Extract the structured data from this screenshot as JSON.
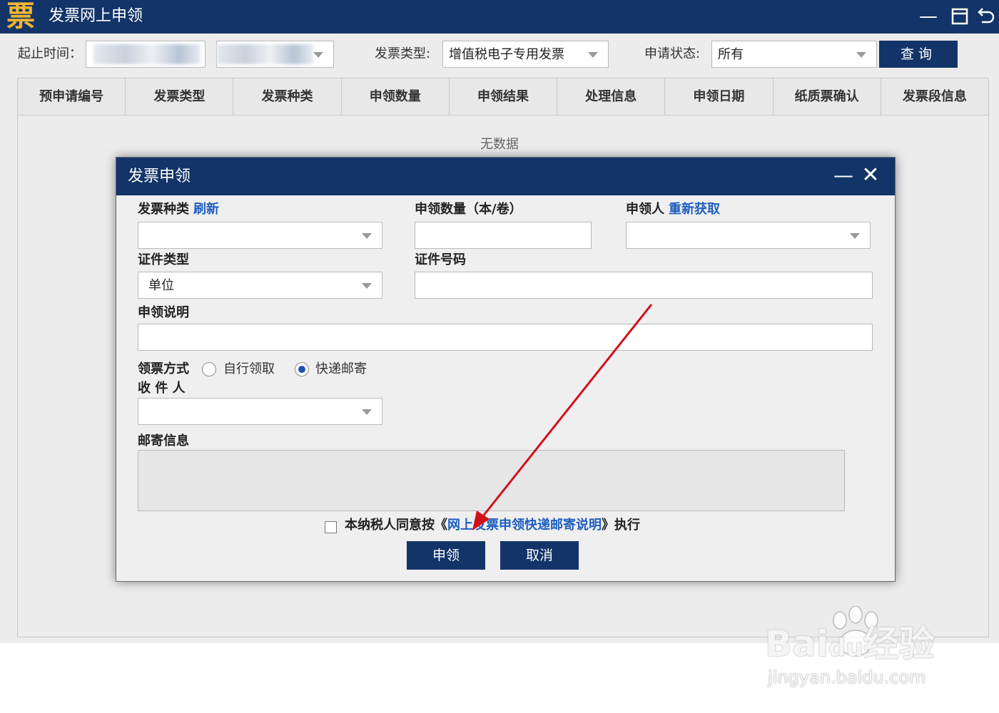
{
  "app": {
    "logo_char": "票",
    "title": "发票网上申领",
    "minimize_glyph": "—",
    "restore_glyph": "⊟",
    "back_glyph": "↺"
  },
  "filters": {
    "time_label": "起止时间：",
    "invoice_type_label": "发票类型:",
    "invoice_type_value": "增值税电子专用发票",
    "status_label": "申请状态:",
    "status_value": "所有",
    "query_button": "查询"
  },
  "grid": {
    "columns": [
      "预申请编号",
      "发票类型",
      "发票种类",
      "申领数量",
      "申领结果",
      "处理信息",
      "申领日期",
      "纸质票确认",
      "发票段信息"
    ],
    "empty_text": "无数据"
  },
  "dialog": {
    "title": "发票申领",
    "minimize_glyph": "—",
    "close_glyph": "✕",
    "invoice_kind_label": "发票种类",
    "refresh_link": "刷新",
    "quantity_label": "申领数量（本/卷）",
    "applicant_label": "申领人",
    "reacquire_link": "重新获取",
    "id_type_label": "证件类型",
    "id_type_value": "单位",
    "id_number_label": "证件号码",
    "description_label": "申领说明",
    "method_label": "领票方式",
    "method_options": [
      "自行领取",
      "快递邮寄"
    ],
    "method_selected": "快递邮寄",
    "recipient_label": "收 件 人",
    "mail_info_label": "邮寄信息",
    "agree_prefix": "本纳税人同意按《",
    "agree_link": "网上发票申领快递邮寄说明",
    "agree_suffix": "》执行",
    "submit_button": "申领",
    "cancel_button": "取消"
  },
  "watermark": {
    "brand": "Bai",
    "brand_tail": "经验",
    "url": "jingyan.baidu.com"
  },
  "colors": {
    "primary": "#123468",
    "link": "#1f5fbf",
    "annotation_arrow": "#d0121b",
    "logo": "#f0b632"
  }
}
